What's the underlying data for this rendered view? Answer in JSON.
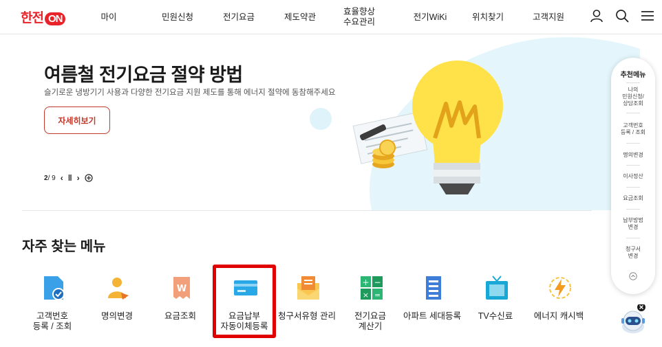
{
  "header": {
    "logo_text": "한전",
    "logo_on": "ON",
    "nav": [
      "마이",
      "민원신청",
      "전기요금",
      "제도약관",
      "효율향상\n수요관리",
      "전기WiKi",
      "위치찾기",
      "고객지원"
    ]
  },
  "banner": {
    "title": "여름철 전기요금 절약 방법",
    "subtitle": "슬기로운 냉방기기 사용과 다양한 전기요금 지원 제도를 통해 에너지 절약에 동참해주세요",
    "button": "자세히보기",
    "pager_current": "2",
    "pager_total": "/ 9",
    "colors": {
      "bulb": "#ffe24a",
      "bg_circle": "#e4f6fb"
    }
  },
  "section": {
    "title": "자주 찾는 메뉴",
    "items": [
      {
        "label": "고객번호\n등록 / 조회",
        "icon": "customer-number-icon"
      },
      {
        "label": "명의변경",
        "icon": "name-change-icon"
      },
      {
        "label": "요금조회",
        "icon": "bill-lookup-icon"
      },
      {
        "label": "요금납부\n자동이체등록",
        "icon": "credit-card-icon"
      },
      {
        "label": "청구서유형 관리",
        "icon": "envelope-icon"
      },
      {
        "label": "전기요금\n계산기",
        "icon": "calculator-icon"
      },
      {
        "label": "아파트 세대등록",
        "icon": "apartment-icon"
      },
      {
        "label": "TV수신료",
        "icon": "tv-icon"
      },
      {
        "label": "에너지 캐시백",
        "icon": "energy-cashback-icon"
      }
    ]
  },
  "quick_menu": {
    "title": "추천메뉴",
    "items": [
      "나의\n민원신청/\n상담조회",
      "고객번호\n등록 / 조회",
      "명의변경",
      "이사정산",
      "요금조회",
      "납부방법\n변경",
      "청구서\n변경"
    ]
  }
}
